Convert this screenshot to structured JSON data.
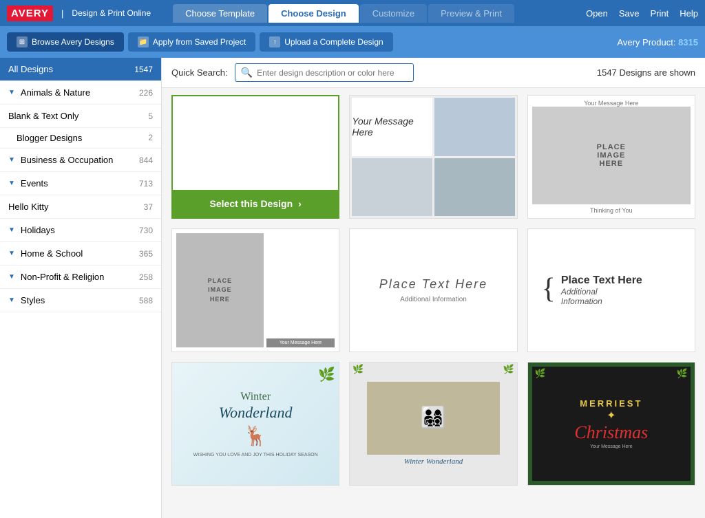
{
  "topNav": {
    "logo": "AVERY",
    "divider": "|",
    "subtitle": "Design & Print Online",
    "tabs": [
      {
        "id": "choose-template",
        "label": "Choose Template",
        "state": "inactive"
      },
      {
        "id": "choose-design",
        "label": "Choose Design",
        "state": "active"
      },
      {
        "id": "customize",
        "label": "Customize",
        "state": "disabled"
      },
      {
        "id": "preview-print",
        "label": "Preview & Print",
        "state": "disabled"
      }
    ],
    "actions": [
      "Open",
      "Save",
      "Print",
      "Help"
    ]
  },
  "subHeader": {
    "buttons": [
      {
        "id": "browse-avery",
        "label": "Browse Avery Designs",
        "icon": "grid-icon",
        "active": true
      },
      {
        "id": "saved-project",
        "label": "Apply from Saved Project",
        "icon": "folder-icon",
        "active": false
      },
      {
        "id": "upload-design",
        "label": "Upload a Complete Design",
        "icon": "upload-icon",
        "active": false
      }
    ],
    "productLabel": "Avery Product:",
    "productNumber": "8315"
  },
  "sidebar": {
    "allDesigns": {
      "label": "All Designs",
      "count": 1547
    },
    "categories": [
      {
        "label": "Animals & Nature",
        "count": 226,
        "hasChevron": true
      },
      {
        "label": "Blank & Text Only",
        "count": 5,
        "hasChevron": false
      },
      {
        "label": "Blogger Designs",
        "count": 2,
        "hasChevron": false,
        "indent": true
      },
      {
        "label": "Business & Occupation",
        "count": 844,
        "hasChevron": true
      },
      {
        "label": "Events",
        "count": 713,
        "hasChevron": true
      },
      {
        "label": "Hello Kitty",
        "count": 37,
        "hasChevron": false
      },
      {
        "label": "Holidays",
        "count": 730,
        "hasChevron": true
      },
      {
        "label": "Home & School",
        "count": 365,
        "hasChevron": true
      },
      {
        "label": "Non-Profit & Religion",
        "count": 258,
        "hasChevron": true
      },
      {
        "label": "Styles",
        "count": 588,
        "hasChevron": true
      }
    ]
  },
  "searchBar": {
    "label": "Quick Search:",
    "placeholder": "Enter design description or color here",
    "resultsText": "1547 Designs are shown"
  },
  "designs": [
    {
      "id": "blank",
      "type": "blank",
      "selected": true,
      "selectLabel": "Select this Design"
    },
    {
      "id": "your-message-photo",
      "type": "your-message-photo"
    },
    {
      "id": "place-image-message",
      "type": "place-image-message"
    },
    {
      "id": "place-image-2",
      "type": "place-image-2"
    },
    {
      "id": "place-text-1",
      "type": "place-text-1"
    },
    {
      "id": "place-text-2",
      "type": "place-text-2"
    },
    {
      "id": "winter-wonderland-1",
      "type": "winter-wonderland-1"
    },
    {
      "id": "winter-wonderland-2",
      "type": "winter-wonderland-2"
    },
    {
      "id": "merriest-christmas",
      "type": "merriest-christmas"
    }
  ]
}
